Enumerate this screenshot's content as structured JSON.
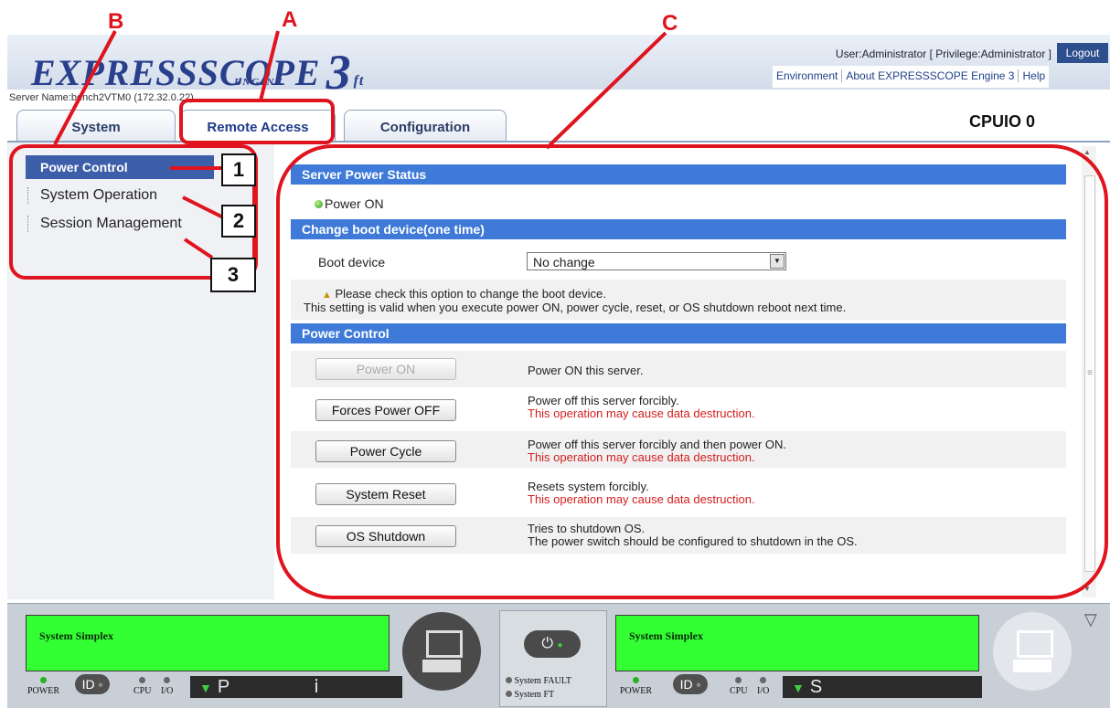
{
  "header": {
    "logo_text": "EXPRESSSCOPE",
    "logo_engine": "ENGINE",
    "logo_number": "3",
    "logo_suffix": "ft",
    "user_info": "User:Administrator [ Privilege:Administrator ]",
    "logout_label": "Logout",
    "links": [
      "Environment",
      "About EXPRESSSCOPE Engine 3",
      "Help"
    ],
    "server_name": "Server Name:bench2VTM0 (172.32.0.22)",
    "page_title": "CPUIO 0"
  },
  "tabs": [
    {
      "label": "System"
    },
    {
      "label": "Remote Access"
    },
    {
      "label": "Configuration"
    }
  ],
  "sidebar": {
    "items": [
      {
        "label": "Power Control",
        "selected": true
      },
      {
        "label": "System Operation"
      },
      {
        "label": "Session Management"
      }
    ]
  },
  "main": {
    "server_power_status": {
      "title": "Server Power Status",
      "status": "Power ON"
    },
    "boot_device": {
      "title": "Change boot device(one time)",
      "label": "Boot device",
      "selected": "No change",
      "note1": "Please check this option to change the boot device.",
      "note2": "This setting is valid when you execute power ON, power cycle, reset, or OS shutdown reboot next time."
    },
    "power_control": {
      "title": "Power Control",
      "rows": [
        {
          "button": "Power ON",
          "desc": "Power ON this server.",
          "warning": "",
          "disabled": true
        },
        {
          "button": "Forces Power OFF",
          "desc": "Power off this server forcibly.",
          "warning": "This operation may cause data destruction."
        },
        {
          "button": "Power Cycle",
          "desc": "Power off this server forcibly and then power ON.",
          "warning": "This operation may cause data destruction."
        },
        {
          "button": "System Reset",
          "desc": "Resets system forcibly.",
          "warning": "This operation may cause data destruction."
        },
        {
          "button": "OS Shutdown",
          "desc": "Tries to shutdown OS.",
          "warning": "The power switch should be configured to shutdown in the OS."
        }
      ]
    }
  },
  "status_panel": {
    "left": {
      "lcd": "System Simplex",
      "power": "POWER",
      "id": "ID",
      "cpu": "CPU",
      "io": "I/O",
      "seg": "P"
    },
    "center": {
      "fault": "System FAULT",
      "ft": "System FT"
    },
    "right": {
      "lcd": "System Simplex",
      "power": "POWER",
      "id": "ID",
      "cpu": "CPU",
      "io": "I/O",
      "seg": "S"
    }
  },
  "annotations": {
    "letters": [
      "A",
      "B",
      "C"
    ],
    "numbers": [
      "1",
      "2",
      "3"
    ],
    "color": "#e0141e"
  },
  "colors": {
    "section_header": "#3f7ad8",
    "nav_selected": "#3d5ea8",
    "lcd": "#33ff33",
    "warning_text": "#d21e1e"
  }
}
